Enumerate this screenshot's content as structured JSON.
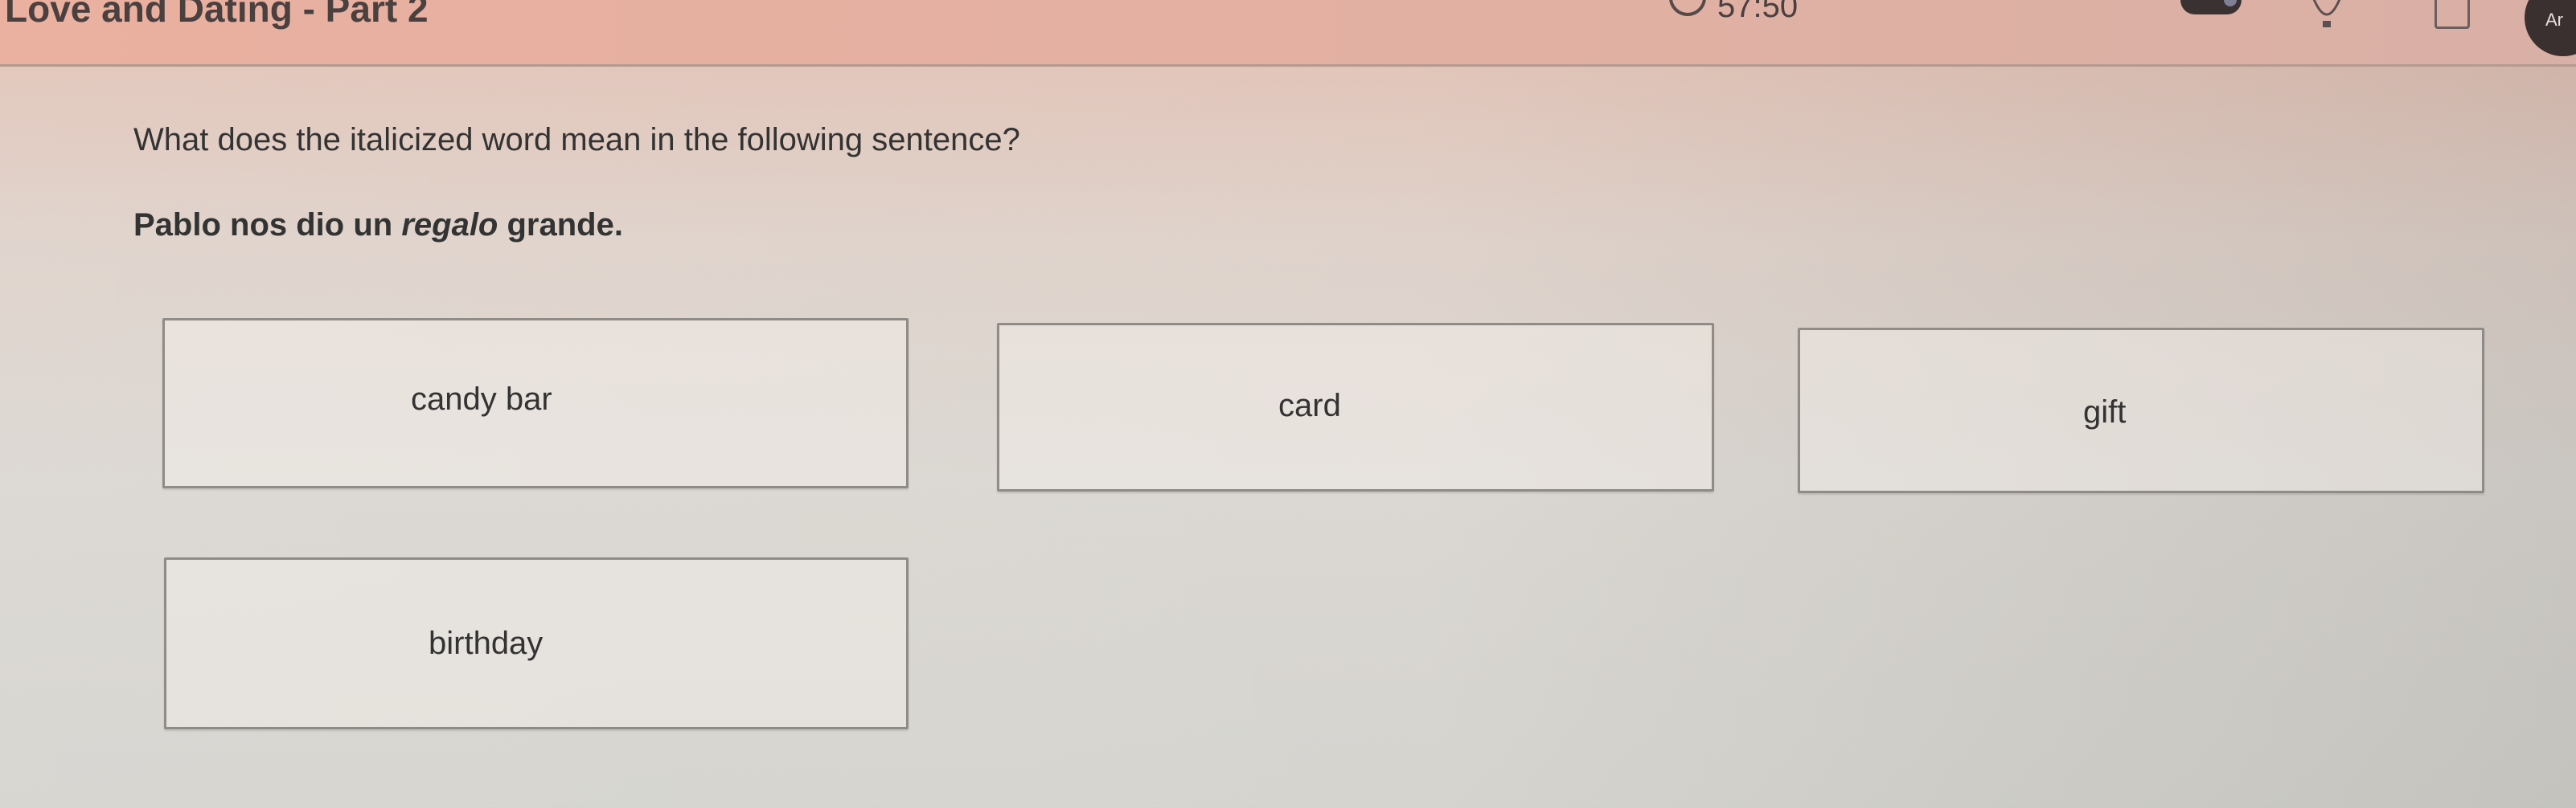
{
  "header": {
    "title": "Love and Dating - Part 2",
    "timer": "57:50",
    "avatar_initials": "Ar"
  },
  "question": {
    "prompt": "What does the italicized word mean in the following sentence?",
    "sentence_before": "Pablo nos dio un ",
    "sentence_italic": "regalo",
    "sentence_after": " grande."
  },
  "choices": [
    {
      "label": "candy bar"
    },
    {
      "label": "card"
    },
    {
      "label": "gift"
    },
    {
      "label": "birthday"
    }
  ],
  "icons": {
    "timer": "timer-icon",
    "toggle": "toggle-switch",
    "hint": "lightbulb-icon",
    "notes": "notes-icon"
  }
}
